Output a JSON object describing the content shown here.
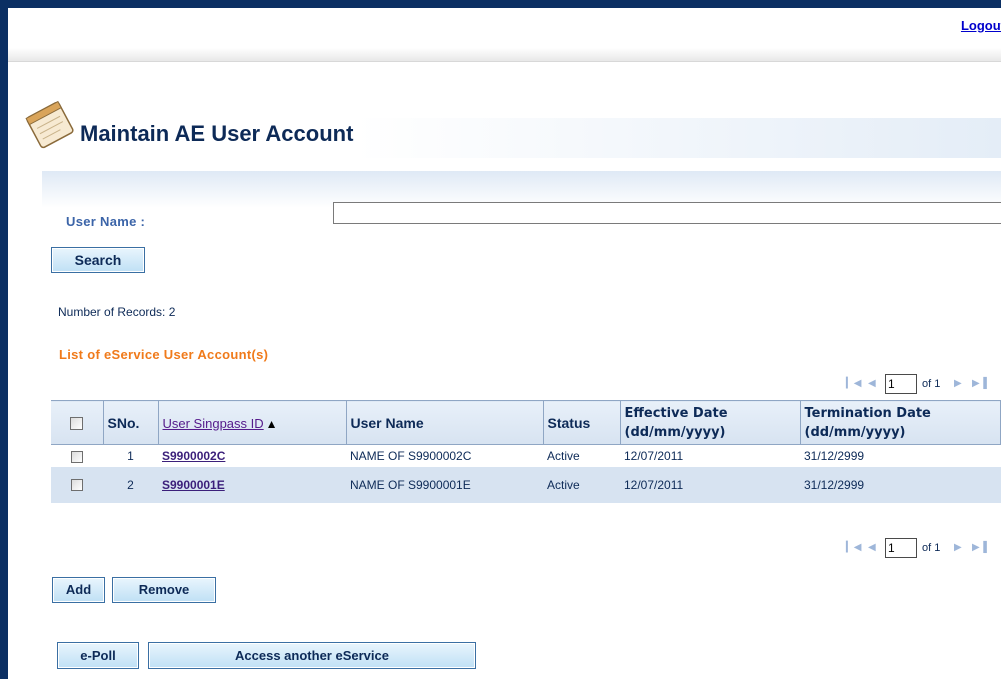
{
  "header": {
    "logout_label": "Logout"
  },
  "page": {
    "title": "Maintain AE User Account",
    "title_icon": "notepad-icon"
  },
  "search": {
    "user_name_label": "User Name :",
    "user_name_value": "",
    "search_label": "Search"
  },
  "records": {
    "count_text": "Number of Records: 2"
  },
  "list": {
    "title": "List of eService User Account(s)"
  },
  "pager": {
    "page": "1",
    "of_text": "of 1"
  },
  "table": {
    "headers": {
      "sno": "SNo.",
      "singpass_id": "User Singpass ID",
      "user_name": "User Name",
      "status": "Status",
      "effective_date": "Effective Date",
      "effective_fmt": "(dd/mm/yyyy)",
      "termination_date": "Termination Date",
      "termination_fmt": "(dd/mm/yyyy)"
    },
    "rows": [
      {
        "sno": "1",
        "id": "S9900002C",
        "name": "NAME OF S9900002C",
        "status": "Active",
        "effective": "12/07/2011",
        "termination": "31/12/2999"
      },
      {
        "sno": "2",
        "id": "S9900001E",
        "name": "NAME OF S9900001E",
        "status": "Active",
        "effective": "12/07/2011",
        "termination": "31/12/2999"
      }
    ]
  },
  "actions": {
    "add_label": "Add",
    "remove_label": "Remove"
  },
  "footer": {
    "epoll_label": "e-Poll",
    "access_label": "Access another eService"
  },
  "colors": {
    "frame": "#0b2f63",
    "accent_orange": "#f07a1a",
    "title_navy": "#0d2a57",
    "row_alt": "#d7e3f1"
  }
}
